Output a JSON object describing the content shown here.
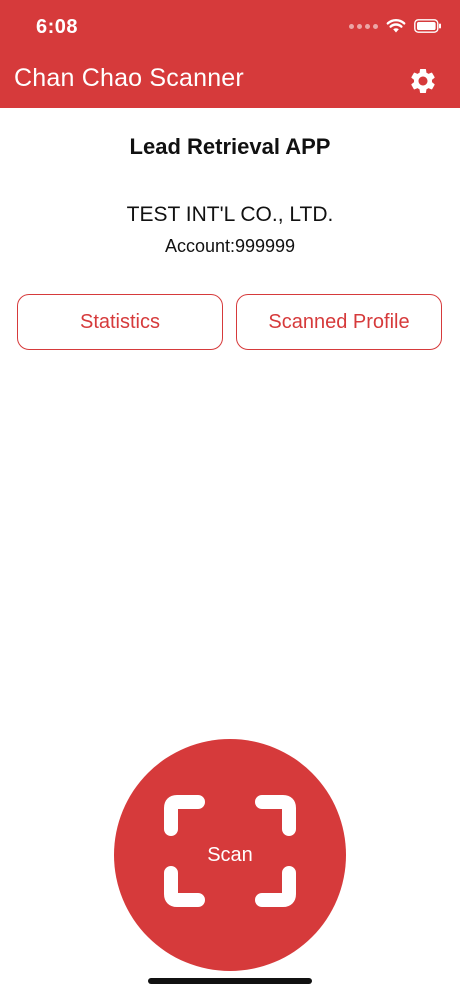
{
  "status_bar": {
    "time": "6:08"
  },
  "header": {
    "title": "Chan Chao Scanner",
    "settings_icon": "gear-icon",
    "background_color": "#d63a3b"
  },
  "main": {
    "heading": "Lead Retrieval APP",
    "company": "TEST INT'L CO., LTD.",
    "account": "Account:999999"
  },
  "buttons": {
    "statistics": "Statistics",
    "scanned_profile": "Scanned Profile"
  },
  "scan": {
    "label": "Scan",
    "icon": "scan-frame-icon"
  },
  "colors": {
    "accent": "#d63a3b",
    "text": "#111111",
    "background": "#ffffff"
  }
}
